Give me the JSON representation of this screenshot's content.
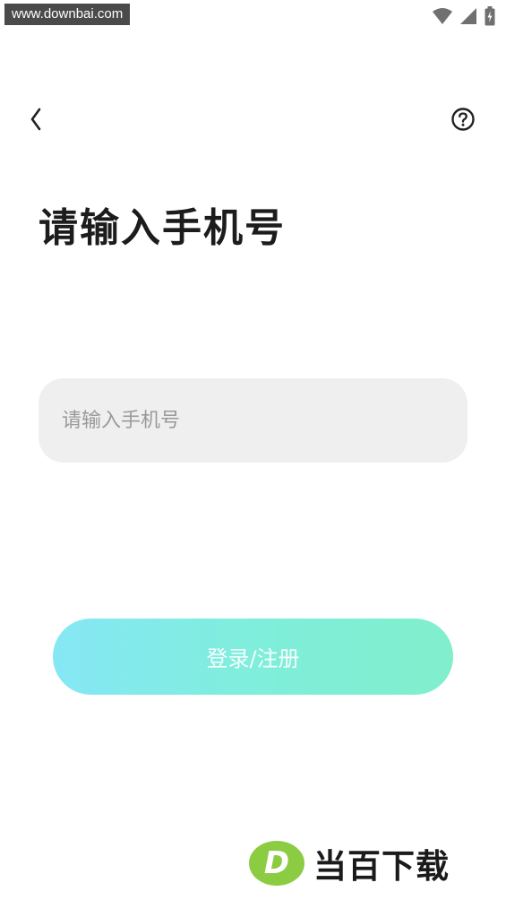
{
  "status_bar": {
    "watermark_url": "www.downbai.com",
    "icons": [
      "wifi-icon",
      "cellular-signal-icon",
      "battery-charging-icon"
    ]
  },
  "nav": {
    "back_icon": "chevron-left-icon",
    "help_icon": "question-circle-icon"
  },
  "page": {
    "title": "请输入手机号"
  },
  "phone_input": {
    "value": "",
    "placeholder": "请输入手机号"
  },
  "login_button": {
    "label": "登录/注册",
    "gradient_start": "#86e7f5",
    "gradient_end": "#81efcc"
  },
  "watermark": {
    "logo_letter": "D",
    "brand_text": "当百下载",
    "logo_color": "#8ccc43"
  }
}
